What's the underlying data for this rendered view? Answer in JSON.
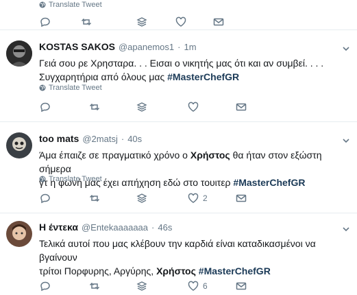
{
  "top": {
    "translate_label": "Translate Tweet"
  },
  "tweets": [
    {
      "name": "KOSTAS SAKOS",
      "handle": "@apanemos1",
      "sep": "·",
      "time": "1m",
      "lines": [
        [
          "Γειά σου ρε Χρησταρα. . . Εισαι ο νικητής μας ότι και αν συμβεί. . . ."
        ],
        [
          "Συγχαρητήρια από όλους μας ",
          "#MasterChefGR"
        ]
      ],
      "translate_label": "Translate Tweet",
      "likes": ""
    },
    {
      "name": "too mats",
      "handle": "@2matsj",
      "sep": "·",
      "time": "40s",
      "line1_pre": "Άμα έπαιζε σε πραγματικό χρόνο ο ",
      "line1_bold": "Χρήστος",
      "line1_post": " θα ήταν στον εξώστη σήμερα",
      "line2_pre": "γτ η φωνή μας έχει απήχηση εδώ στο τουιτερ  ",
      "line2_hash": "#MasterChefGR",
      "translate_label": "Translate Tweet",
      "likes": "2"
    },
    {
      "name": "Η έντεκα",
      "handle": "@Entekaaaaaaa",
      "sep": "·",
      "time": "46s",
      "line1": "Τελικά αυτοί που μας κλέβουν την καρδιά είναι καταδικασμένοι να βγαίνουν",
      "line2_pre": "τρίτοι Πορφυρης, Αργύρης, ",
      "line2_bold": "Χρήστος",
      "line2_hash": "#MasterChefGR",
      "likes": "6"
    }
  ],
  "icons": [
    "globe-icon",
    "reply-icon",
    "retweet-icon",
    "stack-icon",
    "heart-icon",
    "mail-icon",
    "chevron-down-icon"
  ],
  "colors": {
    "muted": "#657786",
    "hashtag": "#1b3a57",
    "divider": "#e6ecf0",
    "text": "#14171a"
  }
}
